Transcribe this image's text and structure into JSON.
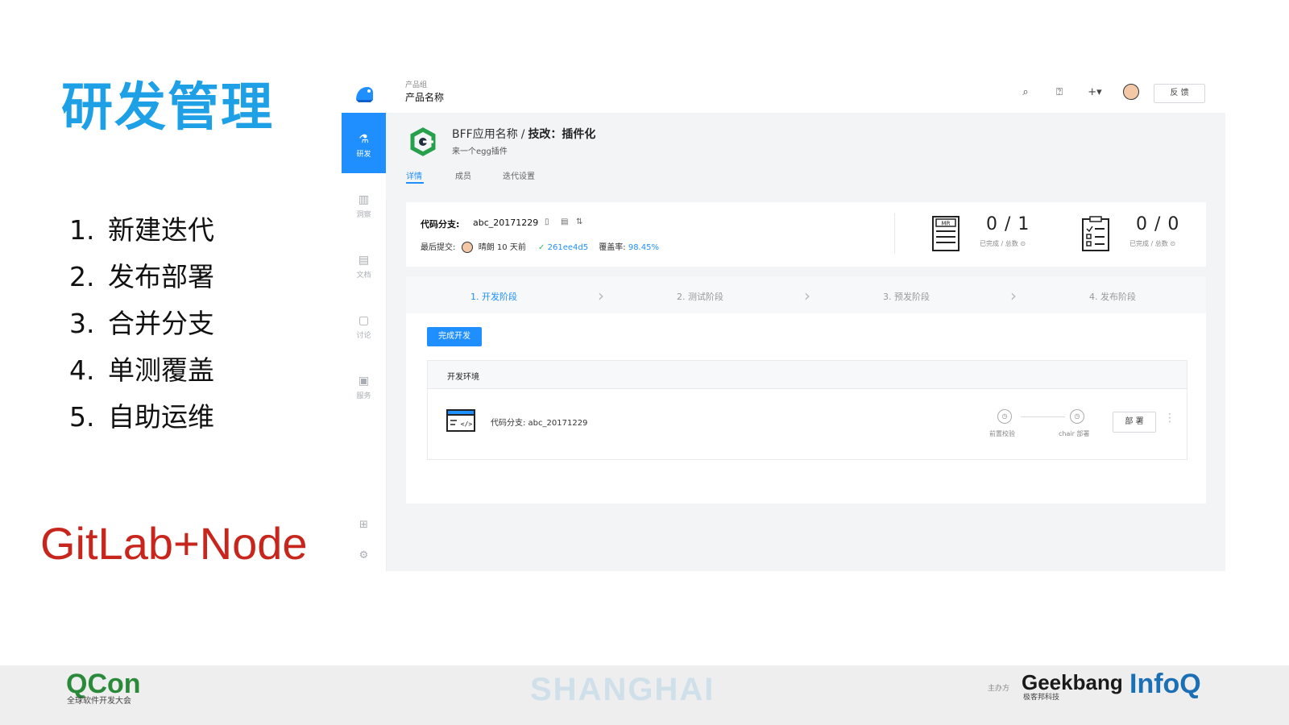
{
  "slide": {
    "title": "研发管理",
    "list": [
      {
        "num": "1.",
        "text": "新建迭代"
      },
      {
        "num": "2.",
        "text": "发布部署"
      },
      {
        "num": "3.",
        "text": "合并分支"
      },
      {
        "num": "4.",
        "text": "单测覆盖"
      },
      {
        "num": "5.",
        "text": "自助运维"
      }
    ],
    "subtitle": "GitLab+Node"
  },
  "app": {
    "breadcrumb_group": "产品组",
    "breadcrumb_name": "产品名称",
    "feedback": "反 馈",
    "toolbar_icons": [
      "search-icon",
      "help-icon",
      "add-icon"
    ],
    "sidebar": [
      {
        "icon": "flask-icon",
        "glyph": "⚗",
        "label": "研发",
        "active": true
      },
      {
        "icon": "chart-icon",
        "glyph": "▥",
        "label": "洞察",
        "active": false
      },
      {
        "icon": "document-icon",
        "glyph": "▤",
        "label": "文档",
        "active": false
      },
      {
        "icon": "chat-icon",
        "glyph": "▢",
        "label": "讨论",
        "active": false
      },
      {
        "icon": "service-icon",
        "glyph": "▣",
        "label": "服务",
        "active": false
      }
    ],
    "header": {
      "app_name": "BFF应用名称",
      "separator": "/",
      "iteration": "技改：插件化",
      "desc": "来一个egg插件",
      "tabs": [
        "详情",
        "成员",
        "迭代设置"
      ]
    },
    "info": {
      "branch_label": "代码分支:",
      "branch_value": "abc_20171229",
      "last_commit_label": "最后提交:",
      "author": "晴朗 10 天前",
      "commit_hash": "261ee4d5",
      "coverage_label": "覆盖率:",
      "coverage_value": "98.45%",
      "mr_icon_text": "MR",
      "mr_stat": "0 / 1",
      "mr_stat_label": "已完成 / 总数",
      "task_stat": "0 / 0",
      "task_stat_label": "已完成 / 总数"
    },
    "stages": [
      "1.  开发阶段",
      "2.  测试阶段",
      "3.  预发阶段",
      "4.  发布阶段"
    ],
    "done_button": "完成开发",
    "env": {
      "title": "开发环境",
      "branch": "代码分支:    abc_20171229",
      "step1": "前置校验",
      "step2": "chair 部署",
      "deploy_button": "部 署"
    }
  },
  "footer": {
    "qcon": "QCon",
    "qcon_sub": "全球软件开发大会",
    "city": "SHANGHAI",
    "host": "主办方",
    "geekbang": "Geekbang",
    "geekbang_sub": "极客邦科技",
    "infoq": "InfoQ"
  },
  "colors": {
    "accent": "#1f8fff",
    "title": "#1ea0e6",
    "subtitle": "#c8261c"
  }
}
